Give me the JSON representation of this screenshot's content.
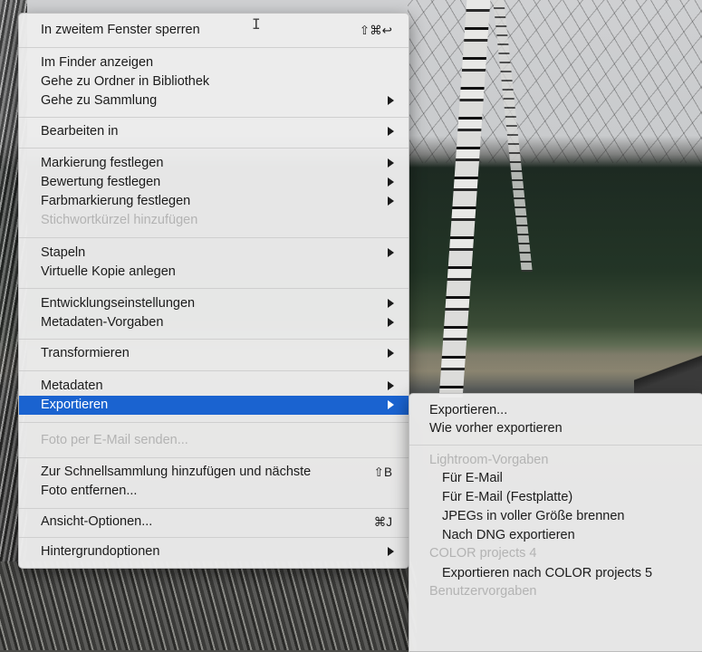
{
  "main_menu": {
    "items": [
      {
        "label": "In zweitem Fenster sperren",
        "shortcut": "⇧⌘↩"
      },
      {
        "label": "Im Finder anzeigen"
      },
      {
        "label": "Gehe zu Ordner in Bibliothek"
      },
      {
        "label": "Gehe zu Sammlung",
        "submenu": true
      },
      {
        "label": "Bearbeiten in",
        "submenu": true
      },
      {
        "label": "Markierung festlegen",
        "submenu": true
      },
      {
        "label": "Bewertung festlegen",
        "submenu": true
      },
      {
        "label": "Farbmarkierung festlegen",
        "submenu": true
      },
      {
        "label": "Stichwortkürzel hinzufügen",
        "disabled": true
      },
      {
        "label": "Stapeln",
        "submenu": true
      },
      {
        "label": "Virtuelle Kopie anlegen"
      },
      {
        "label": "Entwicklungseinstellungen",
        "submenu": true
      },
      {
        "label": "Metadaten-Vorgaben",
        "submenu": true
      },
      {
        "label": "Transformieren",
        "submenu": true
      },
      {
        "label": "Metadaten",
        "submenu": true
      },
      {
        "label": "Exportieren",
        "submenu": true,
        "selected": true
      },
      {
        "label": "Foto per E-Mail senden...",
        "disabled": true
      },
      {
        "label": "Zur Schnellsammlung hinzufügen und nächste",
        "shortcut": "⇧B"
      },
      {
        "label": "Foto entfernen..."
      },
      {
        "label": "Ansicht-Optionen...",
        "shortcut": "⌘J"
      },
      {
        "label": "Hintergrundoptionen",
        "submenu": true
      }
    ]
  },
  "export_submenu": {
    "items": [
      {
        "label": "Exportieren..."
      },
      {
        "label": "Wie vorher exportieren"
      },
      {
        "label": "Lightroom-Vorgaben",
        "header": true
      },
      {
        "label": "Für E-Mail"
      },
      {
        "label": "Für E-Mail (Festplatte)"
      },
      {
        "label": "JPEGs in voller Größe brennen"
      },
      {
        "label": "Nach DNG exportieren"
      },
      {
        "label": "COLOR projects 4",
        "header": true
      },
      {
        "label": "Exportieren nach COLOR projects 5"
      },
      {
        "label": "Benutzervorgaben",
        "header": true
      }
    ]
  },
  "colors": {
    "selection": "#1a63d0",
    "menu_background": "#ececec",
    "disabled_text": "#b3b3b3"
  },
  "icons": {
    "text_cursor": "I-beam-cursor-icon",
    "submenu_arrow": "triangle-right-icon"
  }
}
